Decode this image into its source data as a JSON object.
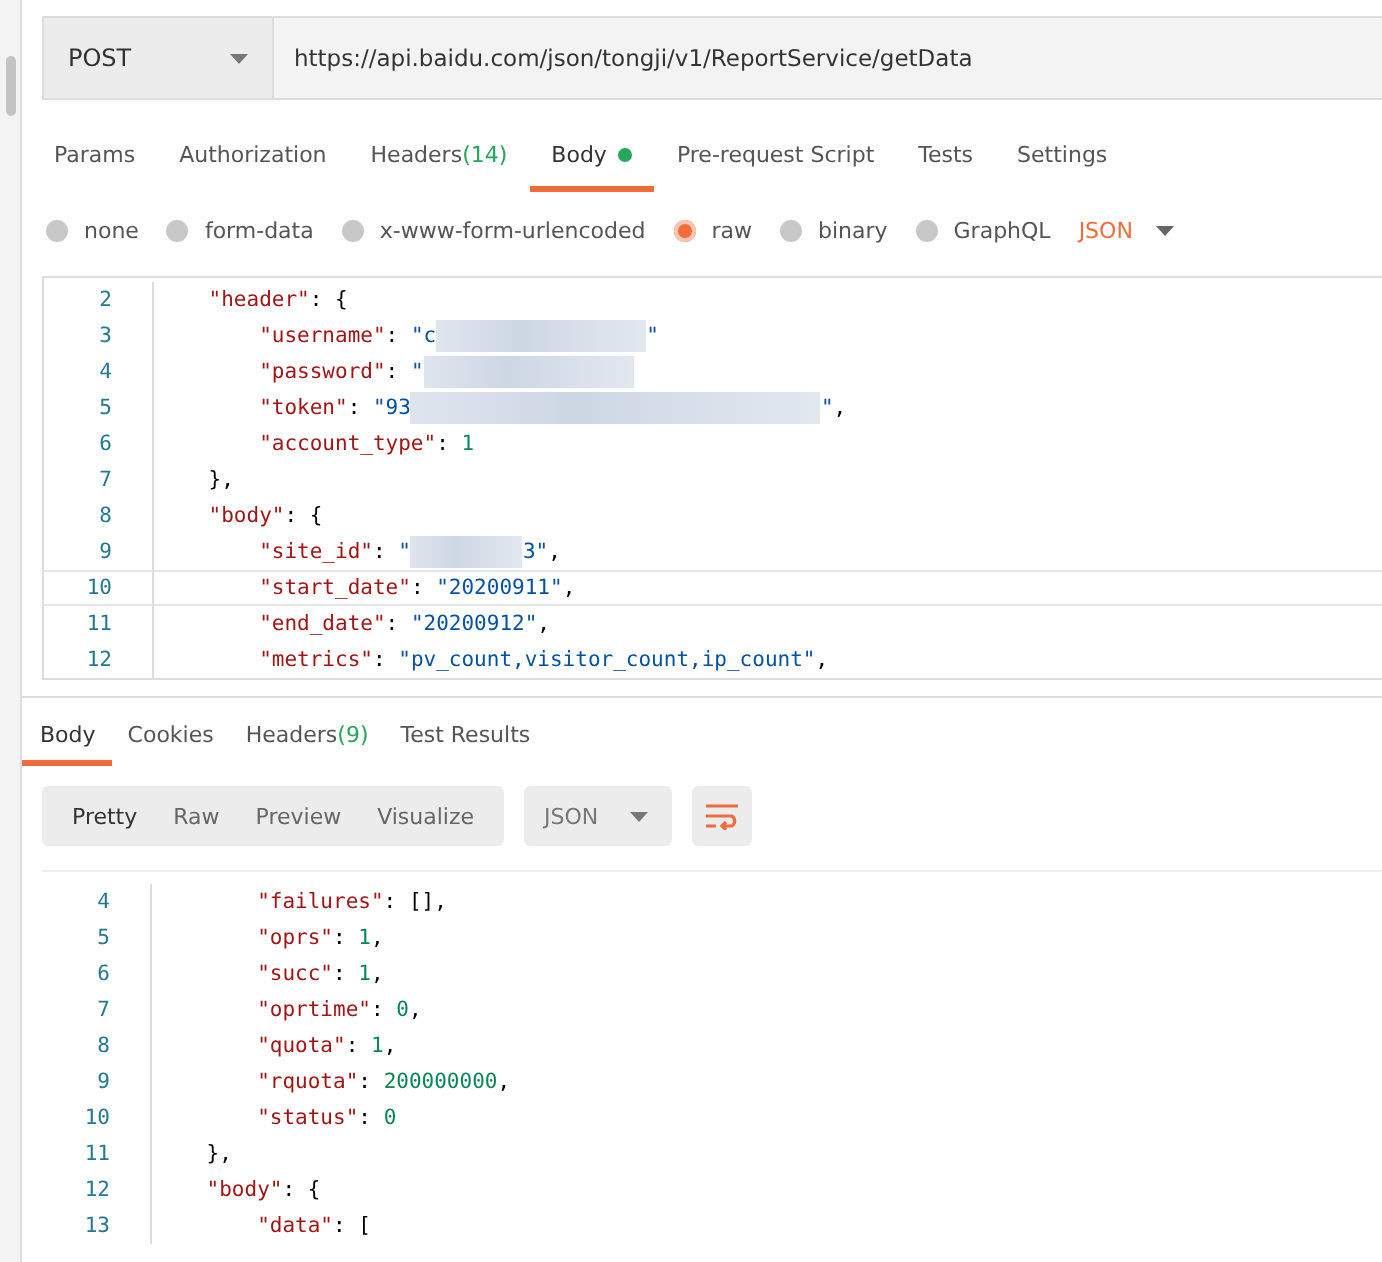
{
  "request": {
    "method": "POST",
    "url": "https://api.baidu.com/json/tongji/v1/ReportService/getData"
  },
  "tabs": [
    {
      "label": "Params",
      "selected": false
    },
    {
      "label": "Authorization",
      "selected": false
    },
    {
      "label": "Headers",
      "count": "(14)",
      "selected": false
    },
    {
      "label": "Body",
      "dot": true,
      "selected": true
    },
    {
      "label": "Pre-request Script",
      "selected": false
    },
    {
      "label": "Tests",
      "selected": false
    },
    {
      "label": "Settings",
      "selected": false
    }
  ],
  "body_types": [
    {
      "label": "none",
      "selected": false
    },
    {
      "label": "form-data",
      "selected": false
    },
    {
      "label": "x-www-form-urlencoded",
      "selected": false
    },
    {
      "label": "raw",
      "selected": true
    },
    {
      "label": "binary",
      "selected": false
    },
    {
      "label": "GraphQL",
      "selected": false
    }
  ],
  "format": "JSON",
  "request_editor": [
    {
      "num": "2",
      "tokens": [
        {
          "kind": "key",
          "t": "    \"header\""
        },
        {
          "kind": "punct",
          "t": ": {"
        }
      ]
    },
    {
      "num": "3",
      "tokens": [
        {
          "kind": "key",
          "t": "        \"username\""
        },
        {
          "kind": "punct",
          "t": ": "
        },
        {
          "kind": "string",
          "t": "\"c"
        },
        {
          "kind": "redactedlong"
        },
        {
          "kind": "string",
          "t": "\""
        }
      ]
    },
    {
      "num": "4",
      "tokens": [
        {
          "kind": "key",
          "t": "        \"password\""
        },
        {
          "kind": "punct",
          "t": ": "
        },
        {
          "kind": "string",
          "t": "\""
        },
        {
          "kind": "redactedlong"
        }
      ]
    },
    {
      "num": "5",
      "tokens": [
        {
          "kind": "key",
          "t": "        \"token\""
        },
        {
          "kind": "punct",
          "t": ": "
        },
        {
          "kind": "string",
          "t": "\"93"
        },
        {
          "kind": "redactedwide"
        },
        {
          "kind": "string",
          "t": "\""
        },
        {
          "kind": "punct",
          "t": ","
        }
      ]
    },
    {
      "num": "6",
      "tokens": [
        {
          "kind": "key",
          "t": "        \"account_type\""
        },
        {
          "kind": "punct",
          "t": ": "
        },
        {
          "kind": "number",
          "t": "1"
        }
      ]
    },
    {
      "num": "7",
      "tokens": [
        {
          "kind": "punct",
          "t": "    },"
        }
      ]
    },
    {
      "num": "8",
      "tokens": [
        {
          "kind": "key",
          "t": "    \"body\""
        },
        {
          "kind": "punct",
          "t": ": {"
        }
      ]
    },
    {
      "num": "9",
      "tokens": [
        {
          "kind": "key",
          "t": "        \"site_id\""
        },
        {
          "kind": "punct",
          "t": ": "
        },
        {
          "kind": "string",
          "t": "\""
        },
        {
          "kind": "redacted"
        },
        {
          "kind": "string",
          "t": "3\""
        },
        {
          "kind": "punct",
          "t": ","
        }
      ]
    },
    {
      "num": "10",
      "tokens": [
        {
          "kind": "key",
          "t": "        \"start_date\""
        },
        {
          "kind": "punct",
          "t": ": "
        },
        {
          "kind": "string",
          "t": "\"20200911\""
        },
        {
          "kind": "punct",
          "t": ","
        }
      ]
    },
    {
      "num": "11",
      "tokens": [
        {
          "kind": "key",
          "t": "        \"end_date\""
        },
        {
          "kind": "punct",
          "t": ": "
        },
        {
          "kind": "string",
          "t": "\"20200912\""
        },
        {
          "kind": "punct",
          "t": ","
        }
      ]
    },
    {
      "num": "12",
      "tokens": [
        {
          "kind": "key",
          "t": "        \"metrics\""
        },
        {
          "kind": "punct",
          "t": ": "
        },
        {
          "kind": "string",
          "t": "\"pv_count,visitor_count,ip_count\""
        },
        {
          "kind": "punct",
          "t": ","
        }
      ]
    }
  ],
  "response_tabs": [
    {
      "label": "Body",
      "selected": true
    },
    {
      "label": "Cookies",
      "selected": false
    },
    {
      "label": "Headers",
      "count": "(9)",
      "selected": false
    },
    {
      "label": "Test Results",
      "selected": false
    }
  ],
  "view_modes": [
    {
      "label": "Pretty",
      "selected": true
    },
    {
      "label": "Raw",
      "selected": false
    },
    {
      "label": "Preview",
      "selected": false
    },
    {
      "label": "Visualize",
      "selected": false
    }
  ],
  "response_format": "JSON",
  "response_editor": [
    {
      "num": "4",
      "tokens": [
        {
          "kind": "key",
          "t": "        \"failures\""
        },
        {
          "kind": "punct",
          "t": ": [],"
        }
      ]
    },
    {
      "num": "5",
      "tokens": [
        {
          "kind": "key",
          "t": "        \"oprs\""
        },
        {
          "kind": "punct",
          "t": ": "
        },
        {
          "kind": "number",
          "t": "1"
        },
        {
          "kind": "punct",
          "t": ","
        }
      ]
    },
    {
      "num": "6",
      "tokens": [
        {
          "kind": "key",
          "t": "        \"succ\""
        },
        {
          "kind": "punct",
          "t": ": "
        },
        {
          "kind": "number",
          "t": "1"
        },
        {
          "kind": "punct",
          "t": ","
        }
      ]
    },
    {
      "num": "7",
      "tokens": [
        {
          "kind": "key",
          "t": "        \"oprtime\""
        },
        {
          "kind": "punct",
          "t": ": "
        },
        {
          "kind": "number",
          "t": "0"
        },
        {
          "kind": "punct",
          "t": ","
        }
      ]
    },
    {
      "num": "8",
      "tokens": [
        {
          "kind": "key",
          "t": "        \"quota\""
        },
        {
          "kind": "punct",
          "t": ": "
        },
        {
          "kind": "number",
          "t": "1"
        },
        {
          "kind": "punct",
          "t": ","
        }
      ]
    },
    {
      "num": "9",
      "tokens": [
        {
          "kind": "key",
          "t": "        \"rquota\""
        },
        {
          "kind": "punct",
          "t": ": "
        },
        {
          "kind": "number",
          "t": "200000000"
        },
        {
          "kind": "punct",
          "t": ","
        }
      ]
    },
    {
      "num": "10",
      "tokens": [
        {
          "kind": "key",
          "t": "        \"status\""
        },
        {
          "kind": "punct",
          "t": ": "
        },
        {
          "kind": "number",
          "t": "0"
        }
      ]
    },
    {
      "num": "11",
      "tokens": [
        {
          "kind": "punct",
          "t": "    },"
        }
      ]
    },
    {
      "num": "12",
      "tokens": [
        {
          "kind": "key",
          "t": "    \"body\""
        },
        {
          "kind": "punct",
          "t": ": {"
        }
      ]
    },
    {
      "num": "13",
      "tokens": [
        {
          "kind": "key",
          "t": "        \"data\""
        },
        {
          "kind": "punct",
          "t": ": ["
        }
      ]
    }
  ]
}
